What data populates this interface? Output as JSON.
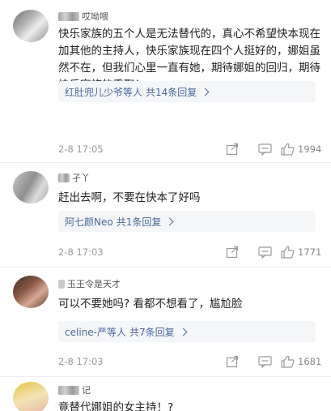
{
  "comments": [
    {
      "name": "哎呦喂",
      "text": "快乐家族的五个人是无法替代的，真心不希望快本现在加其他的主持人，快乐家族现在四个人挺好的，娜姐虽然不在，但我们心里一直有她，期待娜姐的回归，期待快乐家族的重聚！",
      "reply_from": "红肚兜儿少爷等人",
      "reply_count": "共14条回复",
      "time": "2-8 17:05",
      "likes": "1994"
    },
    {
      "name": "孑丫",
      "text": "赶出去啊，不要在快本了好吗",
      "reply_from": "阿七颜Neo",
      "reply_count": "共1条回复",
      "time": "2-8 17:03",
      "likes": "1771"
    },
    {
      "name": "玉王令是天才",
      "text": "可以不要她吗? 看都不想看了，尴尬脸",
      "reply_from": "celine-严等人",
      "reply_count": "共7条回复",
      "time": "2-8 17:03",
      "likes": "1681"
    },
    {
      "name": "记",
      "text": "竟替代娜姐的女主持！?",
      "likes": ""
    }
  ],
  "icons": {
    "share": "share-icon",
    "comment": "comment-icon",
    "like": "thumbs-up-icon",
    "chevron": "chevron-right-icon"
  },
  "colors": {
    "link": "#4a6a9a",
    "reply_bg": "#f5f6f8",
    "meta": "#999999"
  }
}
